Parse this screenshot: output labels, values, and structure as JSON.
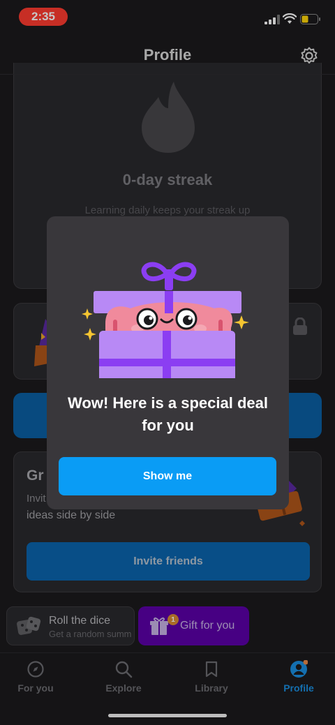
{
  "status_bar": {
    "time": "2:35"
  },
  "header": {
    "title": "Profile"
  },
  "streak": {
    "title": "0-day streak",
    "subtitle": "Learning daily keeps your streak up"
  },
  "group": {
    "title": "Gr",
    "text_line1": "Invit",
    "text_line2": "ideas side by side",
    "invite_label": "Invite friends"
  },
  "chips": {
    "dice_title": "Roll the dice",
    "dice_subtitle": "Get a random summ",
    "gift_label": "Gift for you",
    "gift_badge": "1"
  },
  "tabs": [
    {
      "label": "For you",
      "icon": "compass-icon"
    },
    {
      "label": "Explore",
      "icon": "search-icon"
    },
    {
      "label": "Library",
      "icon": "bookmark-icon"
    },
    {
      "label": "Profile",
      "icon": "profile-icon"
    }
  ],
  "modal": {
    "title": "Wow! Here is a special deal for you",
    "button_label": "Show me"
  },
  "colors": {
    "accent": "#0a9cf5",
    "active_tab": "#1a8fe0",
    "gift_chip": "#5b00a8",
    "modal_bg": "#39373b",
    "gift_box": "#b889f5",
    "ribbon": "#8b3ef2"
  }
}
